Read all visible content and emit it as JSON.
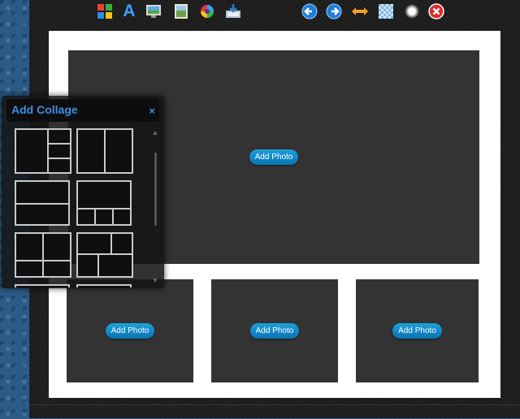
{
  "toolbar": {
    "icons": [
      {
        "name": "layout-colors-icon"
      },
      {
        "name": "text-icon",
        "glyph": "A"
      },
      {
        "name": "background-icon"
      },
      {
        "name": "image-icon"
      },
      {
        "name": "color-wheel-icon"
      },
      {
        "name": "save-icon"
      },
      {
        "name": "undo-icon"
      },
      {
        "name": "redo-icon"
      },
      {
        "name": "swap-icon"
      },
      {
        "name": "transparency-icon"
      },
      {
        "name": "glow-icon"
      },
      {
        "name": "close-icon"
      }
    ]
  },
  "canvas": {
    "slots": [
      {
        "label": "Add Photo"
      },
      {
        "label": "Add Photo"
      },
      {
        "label": "Add Photo"
      },
      {
        "label": "Add Photo"
      }
    ]
  },
  "panel": {
    "title": "Add Collage",
    "close": "×"
  },
  "colors": {
    "accent": "#3b8ee6",
    "button": "#1a8fd3",
    "slot": "#333333",
    "frame": "#ffffff"
  }
}
